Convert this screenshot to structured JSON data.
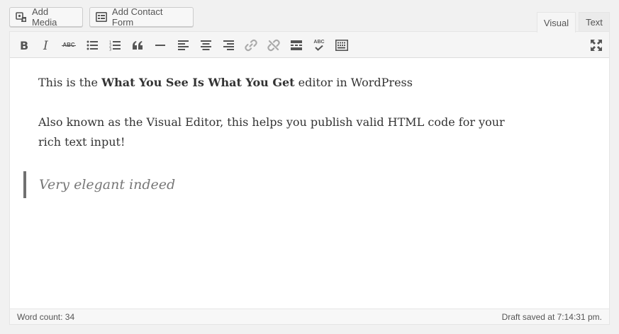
{
  "media_buttons": {
    "add_media": "Add Media",
    "add_contact_form": "Add Contact Form"
  },
  "tabs": {
    "visual": "Visual",
    "text": "Text"
  },
  "toolbar": {
    "icons": [
      "bold-icon",
      "italic-icon",
      "strikethrough-icon",
      "bulleted-list-icon",
      "numbered-list-icon",
      "blockquote-icon",
      "horizontal-line-icon",
      "align-left-icon",
      "align-center-icon",
      "align-right-icon",
      "insert-link-icon",
      "remove-link-icon",
      "read-more-icon",
      "spellcheck-icon",
      "toolbar-toggle-icon",
      "fullscreen-icon"
    ],
    "strike_glyph": "ABC",
    "spell_glyph": "ABC"
  },
  "content": {
    "p1_before": "This is the ",
    "p1_bold": "What You See Is What You Get",
    "p1_after": " editor in WordPress",
    "p2": "Also known as the Visual Editor, this helps you publish valid HTML code for your rich text input!",
    "quote": "Very elegant indeed"
  },
  "status": {
    "word_count": "Word count: 34",
    "draft_saved": "Draft saved at 7:14:31 pm."
  }
}
